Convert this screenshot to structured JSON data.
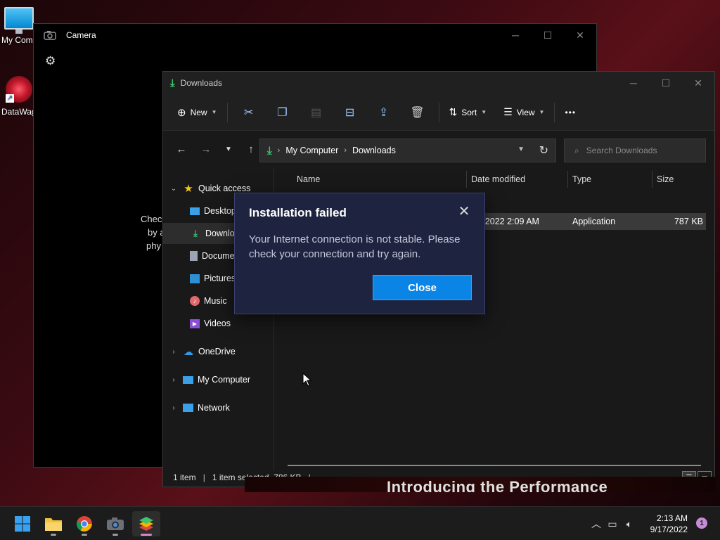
{
  "desktop": {
    "icons": [
      {
        "label": "My Com",
        "icon": "computer-icon"
      },
      {
        "label": "DataWag",
        "icon": "datawag-icon"
      }
    ]
  },
  "camera": {
    "title": "Camera",
    "body_lines": [
      "Chec",
      "by a",
      "phy"
    ]
  },
  "explorer": {
    "title": "Downloads",
    "toolbar": {
      "new_label": "New",
      "sort_label": "Sort",
      "view_label": "View",
      "more_label": "•••"
    },
    "address": {
      "segments": [
        "My Computer",
        "Downloads"
      ]
    },
    "search": {
      "placeholder": "Search Downloads"
    },
    "nav": {
      "quick_access": "Quick access",
      "items": [
        "Desktop",
        "Downloads",
        "Documents",
        "Pictures",
        "Music",
        "Videos"
      ],
      "onedrive": "OneDrive",
      "my_computer": "My Computer",
      "network": "Network"
    },
    "columns": {
      "name": "Name",
      "date": "Date modified",
      "type": "Type",
      "size": "Size"
    },
    "file": {
      "date": "9/17/2022 2:09 AM",
      "type": "Application",
      "size": "787 KB"
    },
    "status": {
      "count": "1 item",
      "selected": "1 item selected  786 KB"
    }
  },
  "dialog": {
    "title": "Installation failed",
    "message": "Your Internet connection is not stable. Please check your connection and try again.",
    "close_label": "Close"
  },
  "background": {
    "video_text": "Introducing the Performance"
  },
  "taskbar": {
    "apps": [
      "start-icon",
      "file-explorer-icon",
      "chrome-icon",
      "camera-icon",
      "bluestacks-icon"
    ],
    "clock": {
      "time": "2:13 AM",
      "date": "9/17/2022"
    },
    "notification_count": "1"
  },
  "colors": {
    "accent": "#0a85e6",
    "dialog_bg": "#1e2340",
    "window_bg": "#191919"
  }
}
